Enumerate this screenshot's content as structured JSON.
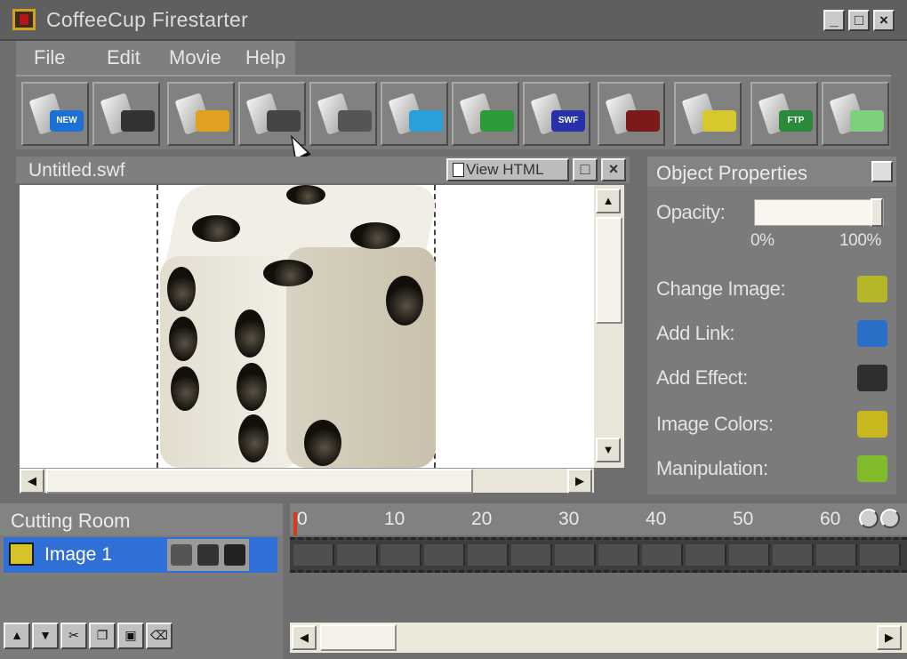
{
  "window": {
    "title": "CoffeeCup Firestarter",
    "controls": {
      "minimize": "_",
      "maximize": "□",
      "close": "×"
    }
  },
  "menu": [
    "File",
    "Edit",
    "Movie",
    "Help"
  ],
  "toolbar": {
    "buttons": [
      {
        "name": "new",
        "icon": "new-document-icon",
        "badge": "NEW",
        "color": "#1d6fd4"
      },
      {
        "name": "save",
        "icon": "save-disk-icon",
        "badge": "",
        "color": "#333333"
      },
      {
        "name": "add-text",
        "icon": "text-tool-icon",
        "badge": "",
        "color": "#e0a020"
      },
      {
        "name": "add-image",
        "icon": "camera-icon",
        "badge": "",
        "color": "#444444"
      },
      {
        "name": "add-sound",
        "icon": "speaker-icon",
        "badge": "",
        "color": "#555555"
      },
      {
        "name": "add-link",
        "icon": "globe-icon",
        "badge": "",
        "color": "#2aa0d8"
      },
      {
        "name": "effects",
        "icon": "color-wheel-icon",
        "badge": "",
        "color": "#2f9a3a"
      },
      {
        "name": "export-swf",
        "icon": "swf-document-icon",
        "badge": "SWF",
        "color": "#2830a8"
      },
      {
        "name": "magic",
        "icon": "magic-hat-icon",
        "badge": "",
        "color": "#7a1a1a"
      },
      {
        "name": "trash",
        "icon": "trash-bin-icon",
        "badge": "",
        "color": "#d6c92e"
      },
      {
        "name": "ftp",
        "icon": "ftp-upload-icon",
        "badge": "FTP",
        "color": "#2a8a3a"
      },
      {
        "name": "preview",
        "icon": "play-preview-icon",
        "badge": "",
        "color": "#7ed07e"
      }
    ]
  },
  "document": {
    "title": "Untitled.swf",
    "view_html_label": "View HTML",
    "btn_restore": "□",
    "btn_close": "×"
  },
  "properties": {
    "title": "Object Properties",
    "opacity_label": "Opacity:",
    "opacity_value": 1.0,
    "opacity_min": "0%",
    "opacity_max": "100%",
    "items": [
      {
        "label": "Change Image:",
        "icon": "folder-open-icon",
        "color": "#b5b52a"
      },
      {
        "label": "Add Link:",
        "icon": "globe-link-icon",
        "color": "#2a70c8"
      },
      {
        "label": "Add Effect:",
        "icon": "magic-hat-small-icon",
        "color": "#2e2e2e"
      },
      {
        "label": "Image Colors:",
        "icon": "color-bars-icon",
        "color": "#c8b81e"
      },
      {
        "label": "Manipulation:",
        "icon": "manipulate-icon",
        "color": "#7fbb2a"
      }
    ]
  },
  "cutting_room": {
    "title": "Cutting Room",
    "layers": [
      {
        "label": "Image 1",
        "selected": true
      }
    ],
    "tools": [
      "▲",
      "▼",
      "✂",
      "❐",
      "▣",
      "⌫"
    ]
  },
  "timeline": {
    "ticks": [
      "0",
      "10",
      "20",
      "30",
      "40",
      "50",
      "60"
    ]
  },
  "colors": {
    "selection": "#2f6fd6",
    "playhead": "#d23c1a",
    "panel": "#7b7b7b"
  }
}
